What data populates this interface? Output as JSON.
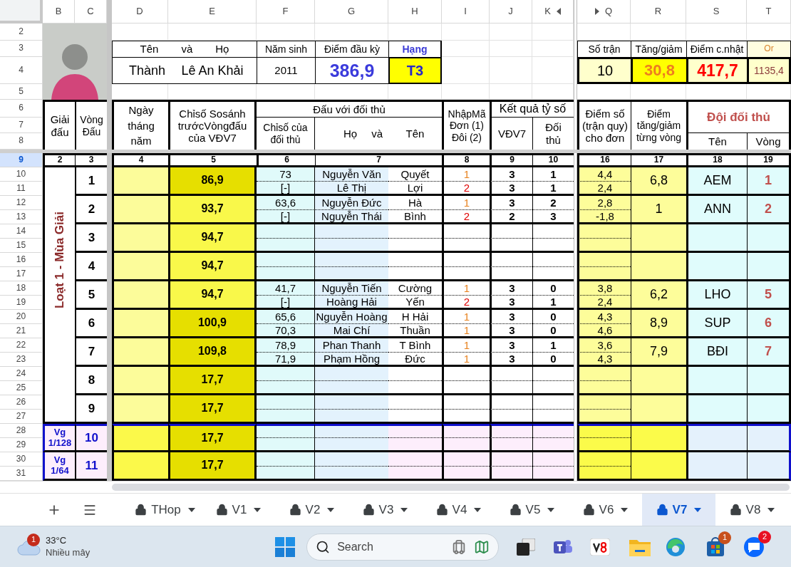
{
  "column_headers": [
    "B",
    "C",
    "D",
    "E",
    "F",
    "G",
    "H",
    "I",
    "J",
    "K",
    "Q",
    "R",
    "S",
    "T"
  ],
  "row_headers": [
    {
      "label": "2",
      "selected": false
    },
    {
      "label": "3",
      "selected": false
    },
    {
      "label": "4",
      "selected": false
    },
    {
      "label": "5",
      "selected": false
    },
    {
      "label": "6",
      "selected": false
    },
    {
      "label": "7",
      "selected": false
    },
    {
      "label": "8",
      "selected": false
    },
    {
      "label": "9",
      "selected": true
    },
    {
      "label": "10",
      "selected": false
    },
    {
      "label": "11",
      "selected": false
    },
    {
      "label": "12",
      "selected": false
    },
    {
      "label": "13",
      "selected": false
    },
    {
      "label": "14",
      "selected": false
    },
    {
      "label": "15",
      "selected": false
    },
    {
      "label": "16",
      "selected": false
    },
    {
      "label": "17",
      "selected": false
    },
    {
      "label": "18",
      "selected": false
    },
    {
      "label": "19",
      "selected": false
    },
    {
      "label": "20",
      "selected": false
    },
    {
      "label": "21",
      "selected": false
    },
    {
      "label": "22",
      "selected": false
    },
    {
      "label": "23",
      "selected": false
    },
    {
      "label": "24",
      "selected": false
    },
    {
      "label": "25",
      "selected": false
    },
    {
      "label": "26",
      "selected": false
    },
    {
      "label": "27",
      "selected": false
    },
    {
      "label": "28",
      "selected": false
    },
    {
      "label": "29",
      "selected": false
    },
    {
      "label": "30",
      "selected": false
    },
    {
      "label": "31",
      "selected": false
    }
  ],
  "player": {
    "name_labels": [
      "Tên",
      "và",
      "Họ"
    ],
    "first_name": "Thành",
    "last_name": "Lê An Khải",
    "birth_year_label": "Năm sinh",
    "birth_year": "2011",
    "start_points_label": "Điểm đầu kỳ",
    "start_points": "386,9",
    "rank_label": "Hạng",
    "rank": "T3"
  },
  "summary": [
    {
      "label": "Số trận",
      "value": "10",
      "kind": "plain"
    },
    {
      "label": "Tăng/giảm",
      "value": "30,8",
      "kind": "change"
    },
    {
      "label": "Điểm c.nhật",
      "value": "417,7",
      "kind": "total"
    },
    {
      "label": "Or",
      "value": "1135,4",
      "kind": "small"
    }
  ],
  "table_header": {
    "tournament": "Giải đấu",
    "round": "Vòng Đấu",
    "date": "Ngày tháng năm",
    "index_before": "Chỉsố Sosánh trướcVòngđấu của VĐV7",
    "opponent": "Đấu với đối thủ",
    "opponent_index": "Chỉsố của đối thủ",
    "opponent_name_labels": [
      "Họ",
      "và",
      "Tên"
    ],
    "code": "NhậpMã Đơn (1) Đôi (2)",
    "result": "Kết quả tỷ số",
    "player_score": "VĐV7",
    "opponent_score": "Đối thủ",
    "points": "Điểm số (trận quy) cho đơn",
    "change": "Điểm tăng/giảm từng vòng",
    "team": "Đội đối thủ",
    "team_name": "Tên",
    "team_round": "Vòng"
  },
  "column_numbers": [
    "2",
    "3",
    "4",
    "5",
    "6",
    "7",
    "8",
    "9",
    "10",
    "16",
    "17",
    "18",
    "19"
  ],
  "groups": [
    {
      "label": "Loạt 1 - Mùa Giải",
      "kind": "season",
      "rounds": [
        {
          "round": "1",
          "index": "86,9",
          "dark": true,
          "change": "6,8",
          "team": "AEM",
          "team_round": "1",
          "matches": [
            {
              "opponent_index": "73",
              "first": "Nguyễn Văn",
              "last": "Quyết",
              "code": "1",
              "color": "#e8821e",
              "score": "3",
              "opponent_score": "1",
              "points": "4,4"
            },
            {
              "opponent_index": "[-]",
              "first": "Lê Thị",
              "last": "Lợi",
              "code": "2",
              "color": "#e00000",
              "score": "3",
              "opponent_score": "1",
              "points": "2,4"
            }
          ]
        },
        {
          "round": "2",
          "index": "93,7",
          "dark": false,
          "change": "1",
          "team": "ANN",
          "team_round": "2",
          "matches": [
            {
              "opponent_index": "63,6",
              "first": "Nguyễn Đức",
              "last": "Hà",
              "code": "1",
              "color": "#e8821e",
              "score": "3",
              "opponent_score": "2",
              "points": "2,8"
            },
            {
              "opponent_index": "[-]",
              "first": "Nguyễn Thái",
              "last": "Bình",
              "code": "2",
              "color": "#e00000",
              "score": "2",
              "opponent_score": "3",
              "points": "-1,8"
            }
          ]
        },
        {
          "round": "3",
          "index": "94,7",
          "dark": false
        },
        {
          "round": "4",
          "index": "94,7",
          "dark": false
        },
        {
          "round": "5",
          "index": "94,7",
          "dark": false,
          "change": "6,2",
          "team": "LHO",
          "team_round": "5",
          "matches": [
            {
              "opponent_index": "41,7",
              "first": "Nguyễn Tiến",
              "last": "Cường",
              "code": "1",
              "color": "#e8821e",
              "score": "3",
              "opponent_score": "0",
              "points": "3,8"
            },
            {
              "opponent_index": "[-]",
              "first": "Hoàng Hải",
              "last": "Yến",
              "code": "2",
              "color": "#e00000",
              "score": "3",
              "opponent_score": "1",
              "points": "2,4"
            }
          ]
        },
        {
          "round": "6",
          "index": "100,9",
          "dark": true,
          "change": "8,9",
          "team": "SUP",
          "team_round": "6",
          "matches": [
            {
              "opponent_index": "65,6",
              "first": "Nguyễn Hoàng",
              "last": "H Hải",
              "code": "1",
              "color": "#e8821e",
              "score": "3",
              "opponent_score": "0",
              "points": "4,3"
            },
            {
              "opponent_index": "70,3",
              "first": "Mai Chí",
              "last": "Thuần",
              "code": "1",
              "color": "#e8821e",
              "score": "3",
              "opponent_score": "0",
              "points": "4,6"
            }
          ]
        },
        {
          "round": "7",
          "index": "109,8",
          "dark": true,
          "change": "7,9",
          "team": "BĐI",
          "team_round": "7",
          "matches": [
            {
              "opponent_index": "78,9",
              "first": "Phan Thanh",
              "last": "T Bình",
              "code": "1",
              "color": "#e8821e",
              "score": "3",
              "opponent_score": "1",
              "points": "3,6"
            },
            {
              "opponent_index": "71,9",
              "first": "Phạm Hồng",
              "last": "Đức",
              "code": "1",
              "color": "#e8821e",
              "score": "3",
              "opponent_score": "0",
              "points": "4,3"
            }
          ]
        },
        {
          "round": "8",
          "index": "17,7",
          "dark": true
        },
        {
          "round": "9",
          "index": "17,7",
          "dark": true
        }
      ]
    },
    {
      "label": "Vg 1/128",
      "kind": "knockout",
      "rounds": [
        {
          "round": "10",
          "index": "17,7",
          "dark": true
        }
      ]
    },
    {
      "label": "Vg 1/64",
      "kind": "knockout",
      "rounds": [
        {
          "round": "11",
          "index": "17,7",
          "dark": true
        }
      ]
    }
  ],
  "sheet_tabs": [
    {
      "label": "THop",
      "selected": false
    },
    {
      "label": "V1",
      "selected": false
    },
    {
      "label": "V2",
      "selected": false
    },
    {
      "label": "V3",
      "selected": false
    },
    {
      "label": "V4",
      "selected": false
    },
    {
      "label": "V5",
      "selected": false
    },
    {
      "label": "V6",
      "selected": false
    },
    {
      "label": "V7",
      "selected": true
    },
    {
      "label": "V8",
      "selected": false
    }
  ],
  "taskbar": {
    "weather_badge": "1",
    "temperature": "33°C",
    "weather": "Nhiều mây",
    "search_placeholder": "Search",
    "store_badge": "1",
    "zalo_badge": "2"
  }
}
